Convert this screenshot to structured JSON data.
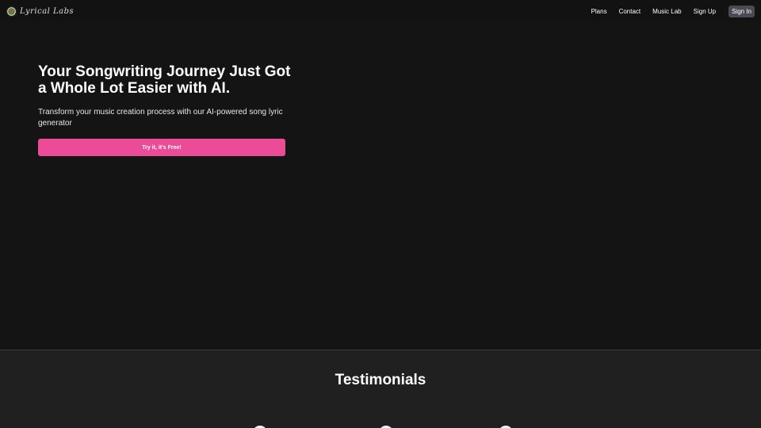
{
  "header": {
    "logo_text": "Lyrical Labs",
    "nav": {
      "plans": "Plans",
      "contact": "Contact",
      "music_lab": "Music Lab",
      "sign_up": "Sign Up",
      "sign_in": "Sign In"
    }
  },
  "hero": {
    "title": "Your Songwriting Journey Just Got a Whole Lot Easier with AI.",
    "subtitle": "Transform your music creation process with our AI-powered song lyric generator",
    "cta_label": "Try it, it's Free!"
  },
  "testimonials": {
    "title": "Testimonials"
  },
  "colors": {
    "background": "#121212",
    "accent": "#ec4b98",
    "sign_in_bg": "#4a4a52",
    "section_bg": "#202020"
  }
}
